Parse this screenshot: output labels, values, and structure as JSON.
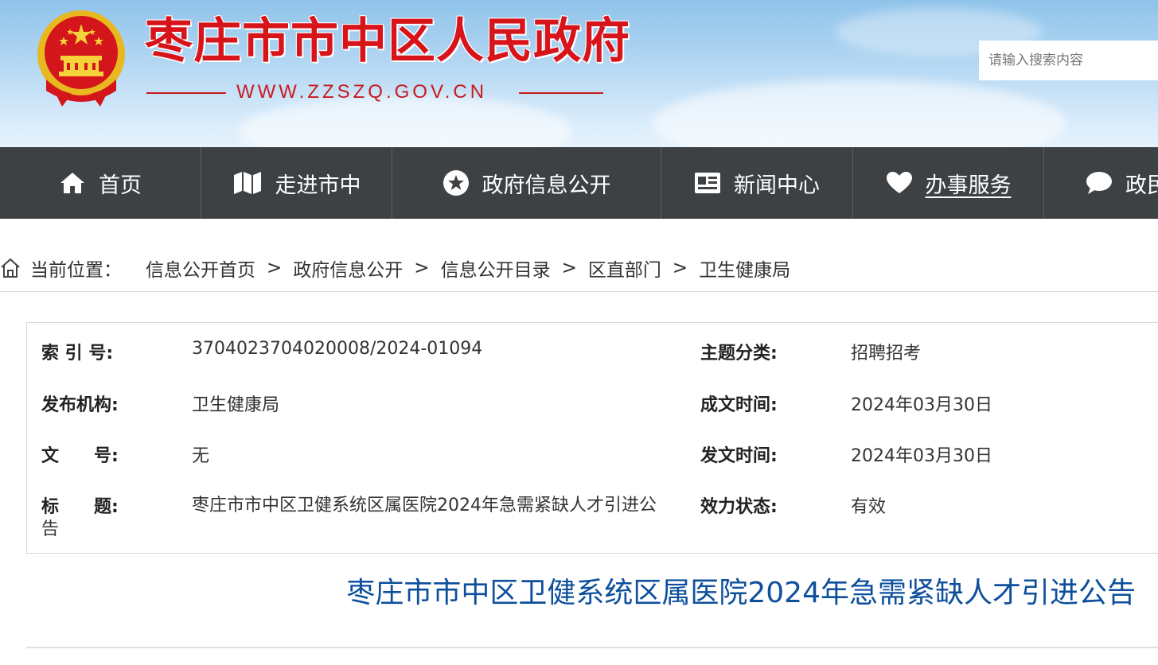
{
  "header": {
    "site_title": "枣庄市市中区人民政府",
    "site_url": "WWW.ZZSZQ.GOV.CN",
    "search_placeholder": "请输入搜索内容",
    "title_color": "#d8141b"
  },
  "nav": {
    "items": [
      {
        "label": "首页",
        "icon": "home-icon"
      },
      {
        "label": "走进市中",
        "icon": "map-icon"
      },
      {
        "label": "政府信息公开",
        "icon": "star-circle-icon"
      },
      {
        "label": "新闻中心",
        "icon": "news-card-icon"
      },
      {
        "label": "办事服务",
        "icon": "heart-icon",
        "active": true
      },
      {
        "label": "政民互动",
        "icon": "chat-bubble-icon"
      }
    ],
    "background": "#3d4144"
  },
  "breadcrumb": {
    "label": "当前位置：",
    "items": [
      "信息公开首页",
      "政府信息公开",
      "信息公开目录",
      "区直部门",
      "卫生健康局"
    ],
    "separator": ">"
  },
  "meta": {
    "index_label": "索 引 号:",
    "index_value": "3704023704020008/2024-01094",
    "topic_label": "主题分类:",
    "topic_value": "招聘招考",
    "publisher_label": "发布机构:",
    "publisher_value": "卫生健康局",
    "created_label": "成文时间:",
    "created_value": "2024年03月30日",
    "docno_label": "文　　号:",
    "docno_value": "无",
    "issued_label": "发文时间:",
    "issued_value": "2024年03月30日",
    "title_label": "标　　题:",
    "title_value": "枣庄市市中区卫健系统区属医院2024年急需紧缺人才引进公告",
    "status_label": "效力状态:",
    "status_value": "有效"
  },
  "article": {
    "title": "枣庄市市中区卫健系统区属医院2024年急需紧缺人才引进公告",
    "title_color": "#0d4f9c"
  }
}
